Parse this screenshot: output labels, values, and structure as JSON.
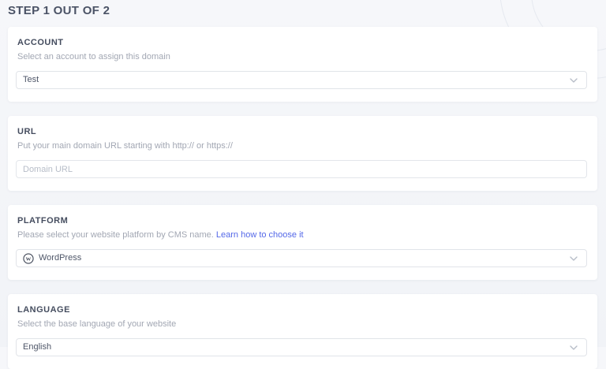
{
  "page": {
    "title": "STEP 1 OUT OF 2"
  },
  "colors": {
    "background": "#f2f4f8",
    "card": "#ffffff",
    "label_text": "#454d5f",
    "description_text": "#a2a7b3",
    "value_text": "#4e5668",
    "placeholder_text": "#b7bdc8",
    "link": "#5468e8",
    "field_border": "#e1e4e9"
  },
  "sections": [
    {
      "id": "account",
      "label": "ACCOUNT",
      "description": "Select an account to assign this domain",
      "field": {
        "type": "select",
        "value": "Test",
        "icon": "chevron-down-icon"
      }
    },
    {
      "id": "url",
      "label": "URL",
      "description": "Put your main domain URL starting with http:// or https://",
      "field": {
        "type": "input",
        "value": "",
        "placeholder": "Domain URL"
      }
    },
    {
      "id": "platform",
      "label": "PLATFORM",
      "description": "Please select your website platform by CMS name.",
      "link_label": "Learn how to choose it",
      "field": {
        "type": "select",
        "value": "WordPress",
        "icon": "wordpress-icon"
      }
    },
    {
      "id": "language",
      "label": "LANGUAGE",
      "description": "Select the base language of your website",
      "field": {
        "type": "select",
        "value": "English",
        "icon": "chevron-down-icon"
      }
    }
  ]
}
